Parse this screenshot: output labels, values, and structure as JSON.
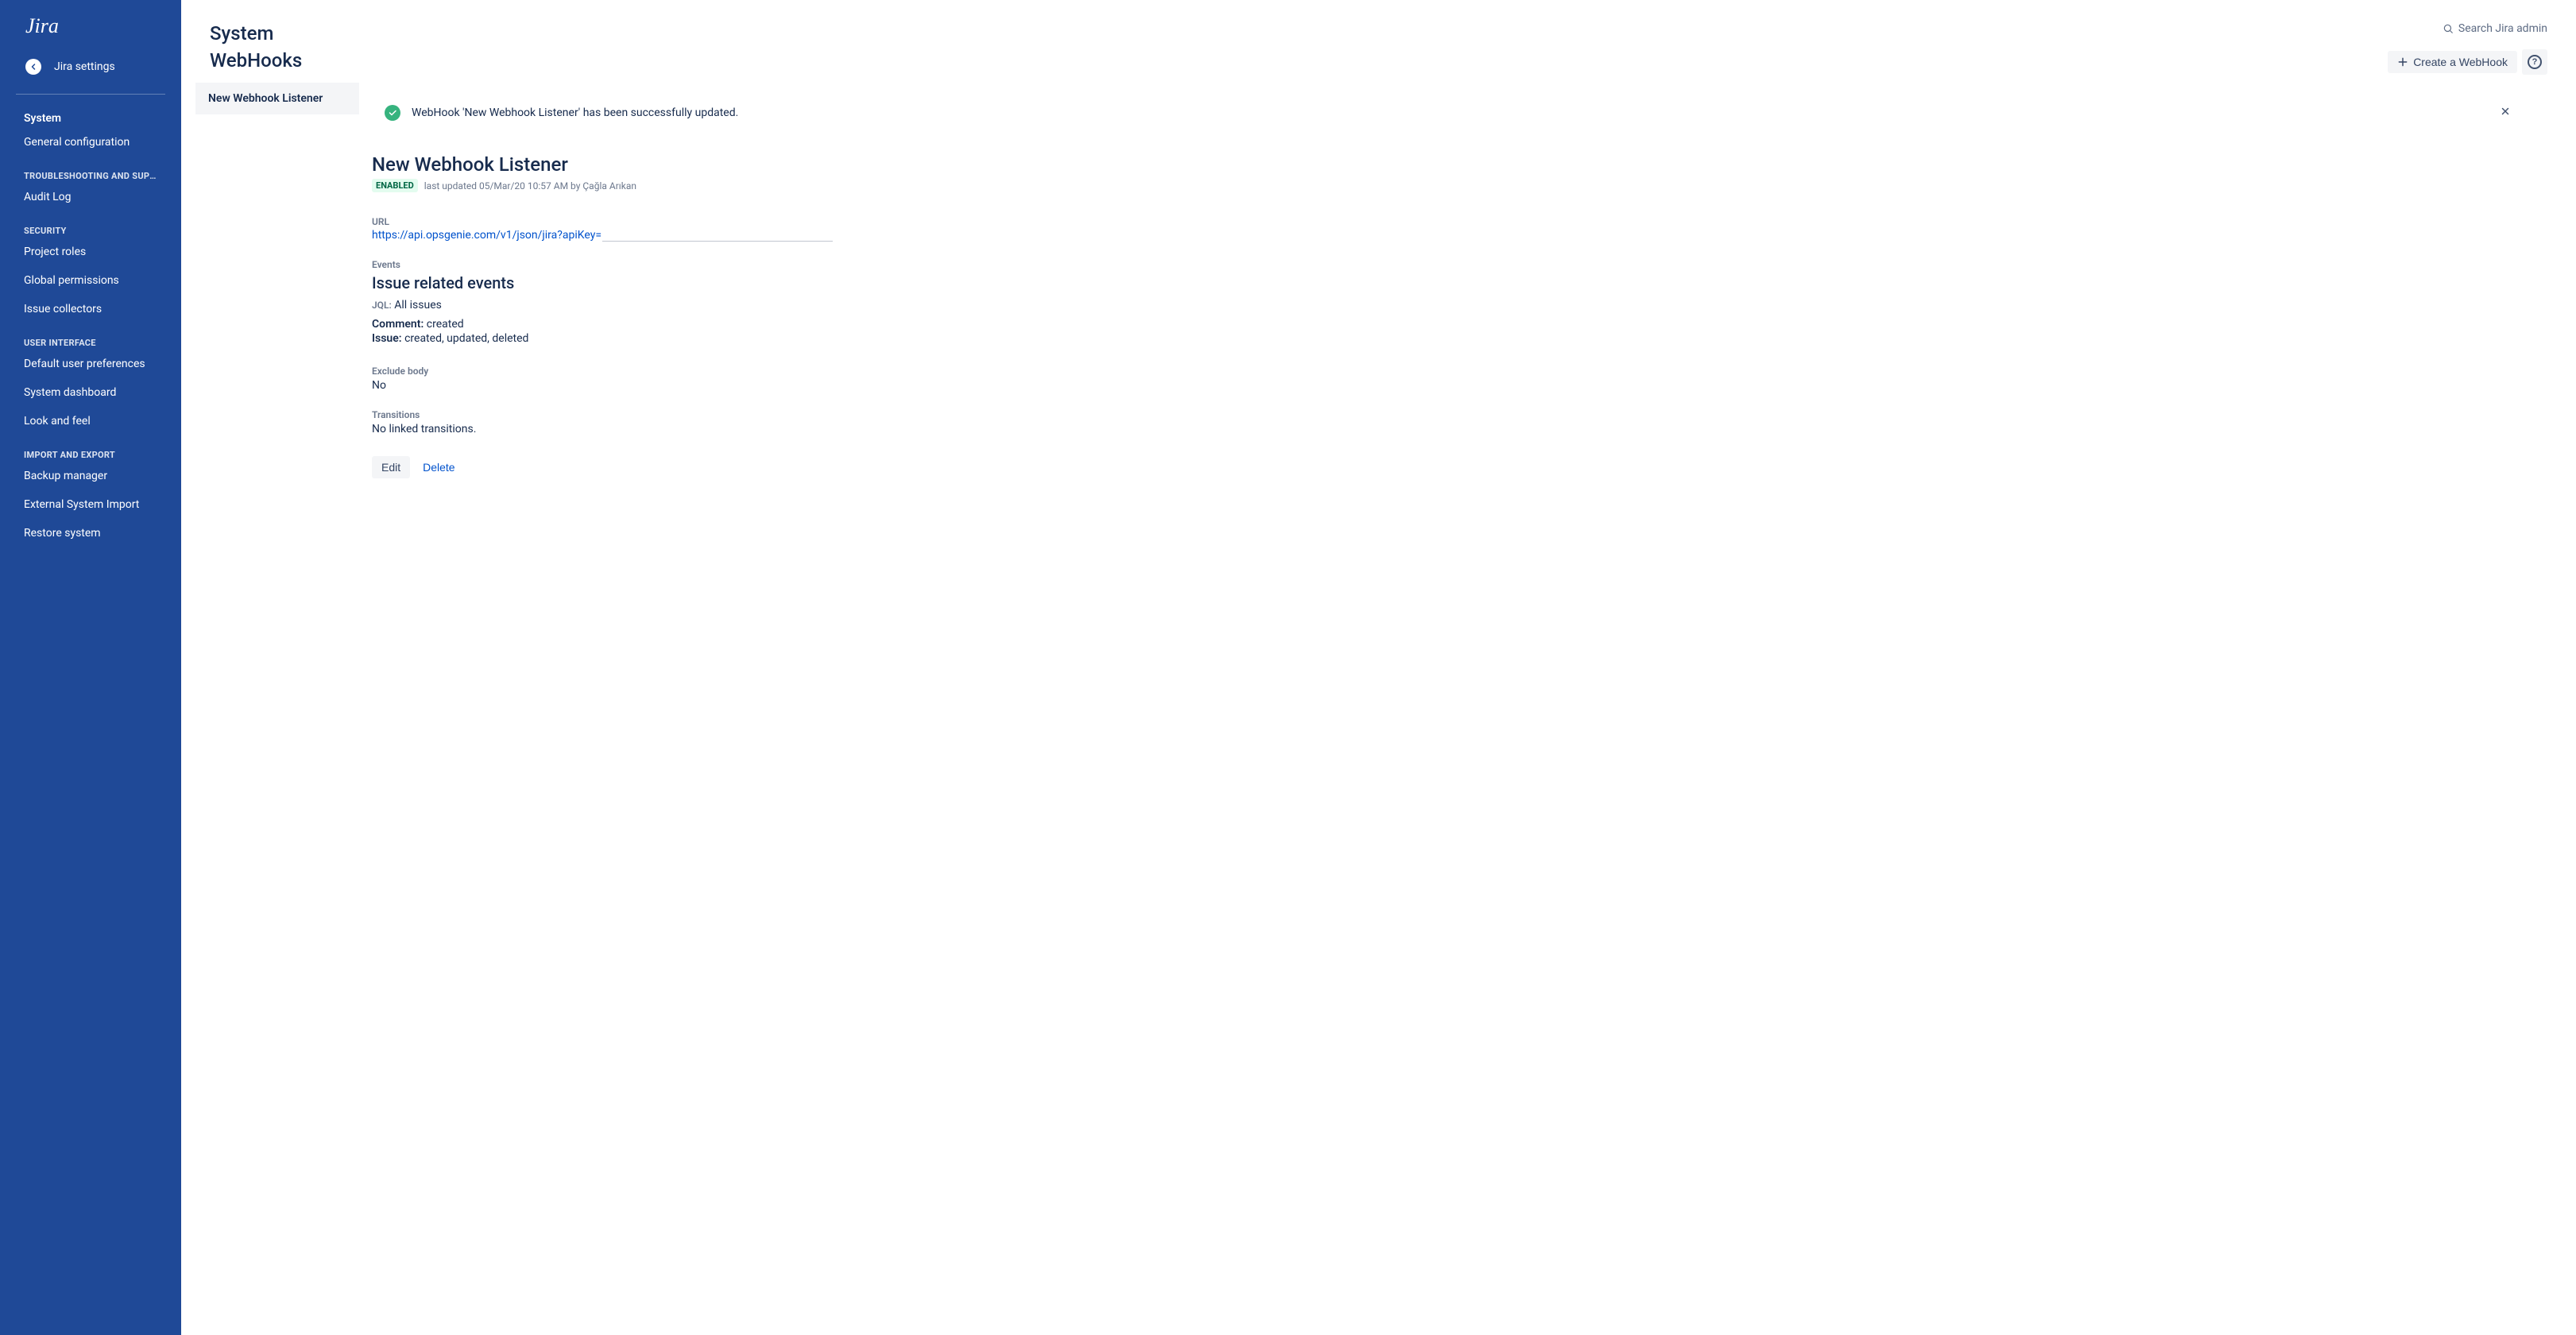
{
  "app": {
    "logo": "Jira"
  },
  "sidebar": {
    "back_label": "Jira settings",
    "section_title": "System",
    "groups": [
      {
        "heading": null,
        "items": [
          "General configuration"
        ]
      },
      {
        "heading": "TROUBLESHOOTING AND SUPP…",
        "items": [
          "Audit Log"
        ]
      },
      {
        "heading": "SECURITY",
        "items": [
          "Project roles",
          "Global permissions",
          "Issue collectors"
        ]
      },
      {
        "heading": "USER INTERFACE",
        "items": [
          "Default user preferences",
          "System dashboard",
          "Look and feel"
        ]
      },
      {
        "heading": "IMPORT AND EXPORT",
        "items": [
          "Backup manager",
          "External System Import",
          "Restore system"
        ]
      }
    ]
  },
  "header": {
    "title": "System",
    "subtitle": "WebHooks",
    "search_placeholder": "Search Jira admin",
    "create_label": "Create a WebHook"
  },
  "listeners": {
    "items": [
      "New Webhook Listener"
    ]
  },
  "alert": {
    "message": "WebHook 'New Webhook Listener' has been successfully updated."
  },
  "detail": {
    "title": "New Webhook Listener",
    "status": "ENABLED",
    "last_updated": "last updated 05/Mar/20 10:57 AM by Çağla Arıkan",
    "url_label": "URL",
    "url": "https://api.opsgenie.com/v1/json/jira?apiKey=",
    "events_label": "Events",
    "events_group_title": "Issue related events",
    "jql_label": "JQL:",
    "jql_value": "All issues",
    "event_rows": [
      {
        "label": "Comment:",
        "value": "created"
      },
      {
        "label": "Issue:",
        "value": "created, updated, deleted"
      }
    ],
    "exclude_body_label": "Exclude body",
    "exclude_body_value": "No",
    "transitions_label": "Transitions",
    "transitions_value": "No linked transitions.",
    "edit_label": "Edit",
    "delete_label": "Delete"
  }
}
